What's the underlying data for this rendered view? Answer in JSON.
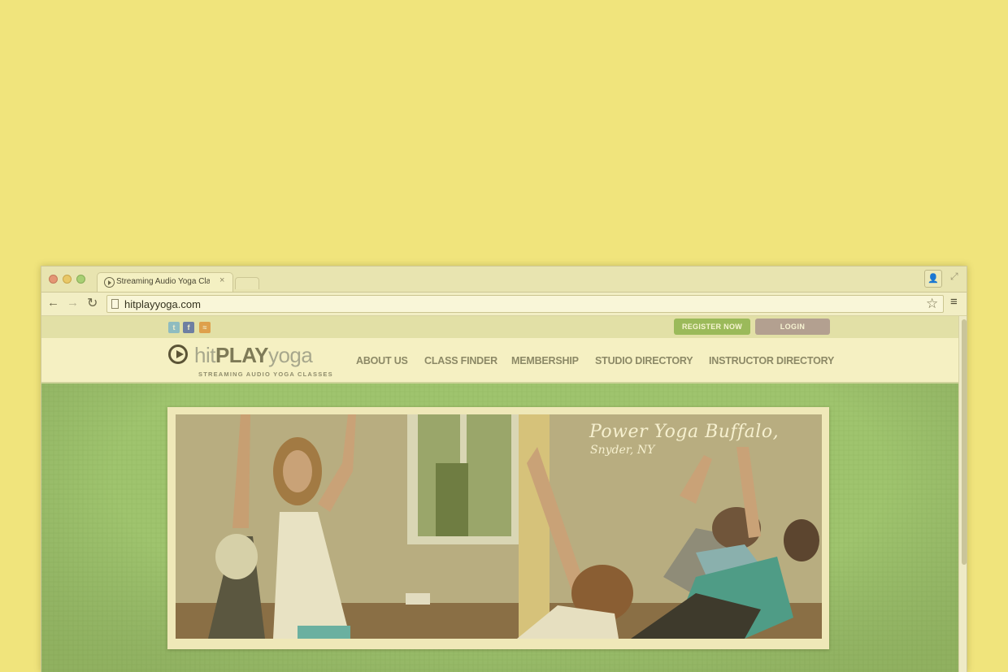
{
  "browser": {
    "tab_title": "Streaming Audio Yoga Cla",
    "tab_close": "×",
    "url": "hitplayyoga.com",
    "icons": [
      "close-dot",
      "minimize-dot",
      "maximize-dot",
      "back-icon",
      "forward-icon",
      "reload-icon",
      "page-icon",
      "star-icon",
      "menu-icon",
      "profile-icon",
      "fullscreen-icon"
    ],
    "glyphs": {
      "back": "←",
      "forward": "→",
      "reload": "↻",
      "star": "☆",
      "menu": "≡",
      "profile": "👤",
      "fullscreen": "⤢"
    }
  },
  "site": {
    "social": {
      "twitter": "t",
      "facebook": "f",
      "rss": "≈"
    },
    "register_label": "REGISTER NOW",
    "login_label": "LOGIN",
    "logo": {
      "hit": "hit",
      "play": "PLAY",
      "yoga": "yoga",
      "tagline": "STREAMING AUDIO YOGA CLASSES"
    },
    "nav": [
      "ABOUT US",
      "CLASS FINDER",
      "MEMBERSHIP",
      "STUDIO DIRECTORY",
      "INSTRUCTOR DIRECTORY"
    ],
    "hero": {
      "title": "Power Yoga Buffalo,",
      "subtitle": "Snyder, NY"
    }
  },
  "colors": {
    "background": "#f0e47c",
    "page_green": "#9fc46e",
    "register_button": "#9bba5a",
    "login_button": "#b3a090",
    "nav_text": "#8c8966"
  }
}
